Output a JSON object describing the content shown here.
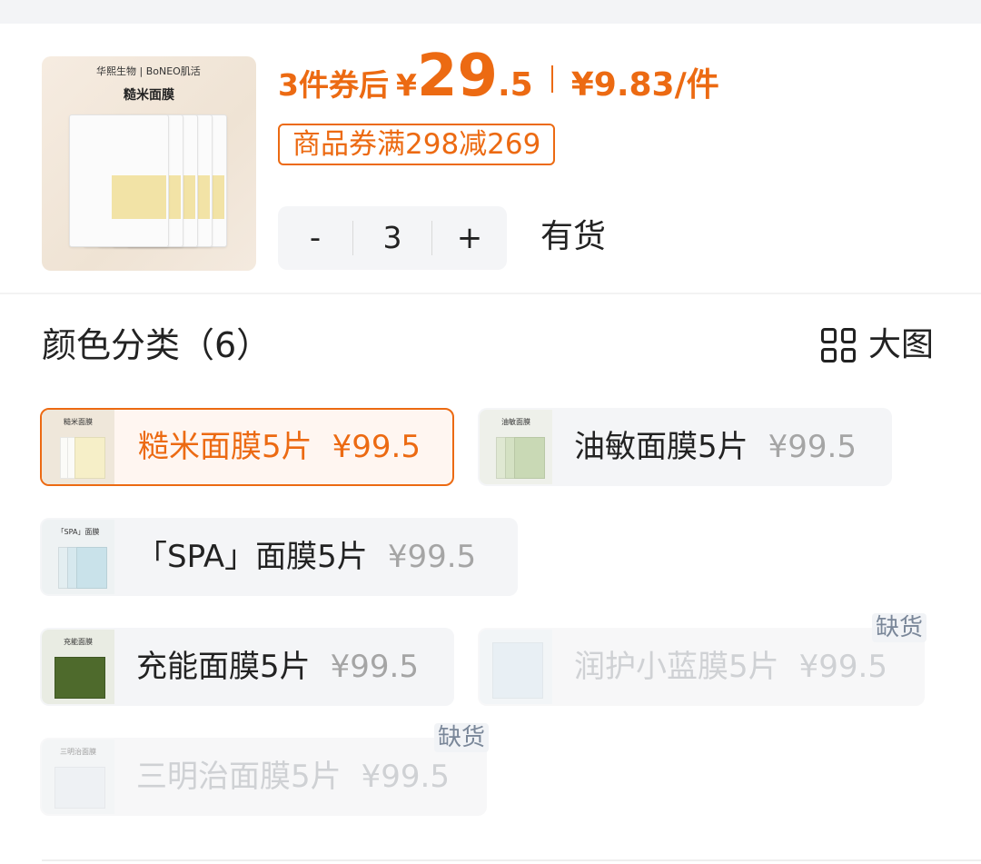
{
  "product": {
    "thumb_brand": "华熙生物 | BoNEO肌活",
    "thumb_name": "糙米面膜",
    "price_prefix": "3件券后",
    "currency": "¥",
    "price_int": "29",
    "price_dec": ".5",
    "unit_price": "¥9.83/件",
    "coupon": "商品券满298减269",
    "stepper": {
      "minus": "-",
      "value": "3",
      "plus": "+"
    },
    "stock": "有货"
  },
  "variants_section": {
    "title": "颜色分类（6）",
    "big_image_label": "大图",
    "big_image_icon": "grid-icon"
  },
  "variants": [
    {
      "name": "糙米面膜5片",
      "price": "¥99.5",
      "selected": true,
      "out_of_stock": false,
      "swatch_color": "#efe7da",
      "swatch_label": "糙米面膜"
    },
    {
      "name": "油敏面膜5片",
      "price": "¥99.5",
      "selected": false,
      "out_of_stock": false,
      "swatch_color": "#dfe7d3",
      "swatch_label": "油敏面膜"
    },
    {
      "name": "「SPA」面膜5片",
      "price": "¥99.5",
      "selected": false,
      "out_of_stock": false,
      "swatch_color": "#e6eef0",
      "swatch_label": "「SPA」面膜"
    },
    {
      "name": "充能面膜5片",
      "price": "¥99.5",
      "selected": false,
      "out_of_stock": false,
      "swatch_color": "#4e6a2c",
      "swatch_label": "充能面膜"
    },
    {
      "name": "润护小蓝膜5片",
      "price": "¥99.5",
      "selected": false,
      "out_of_stock": true,
      "badge": "缺货",
      "swatch_color": "#d8e6f0",
      "swatch_label": ""
    },
    {
      "name": "三明治面膜5片",
      "price": "¥99.5",
      "selected": false,
      "out_of_stock": true,
      "badge": "缺货",
      "swatch_color": "#e8eef2",
      "swatch_label": "三明治面膜"
    }
  ],
  "colors": {
    "accent": "#ec6a12",
    "muted_price": "#a5a5a5",
    "disabled_text": "#cfd1d4",
    "chip_bg": "#f4f5f7"
  }
}
